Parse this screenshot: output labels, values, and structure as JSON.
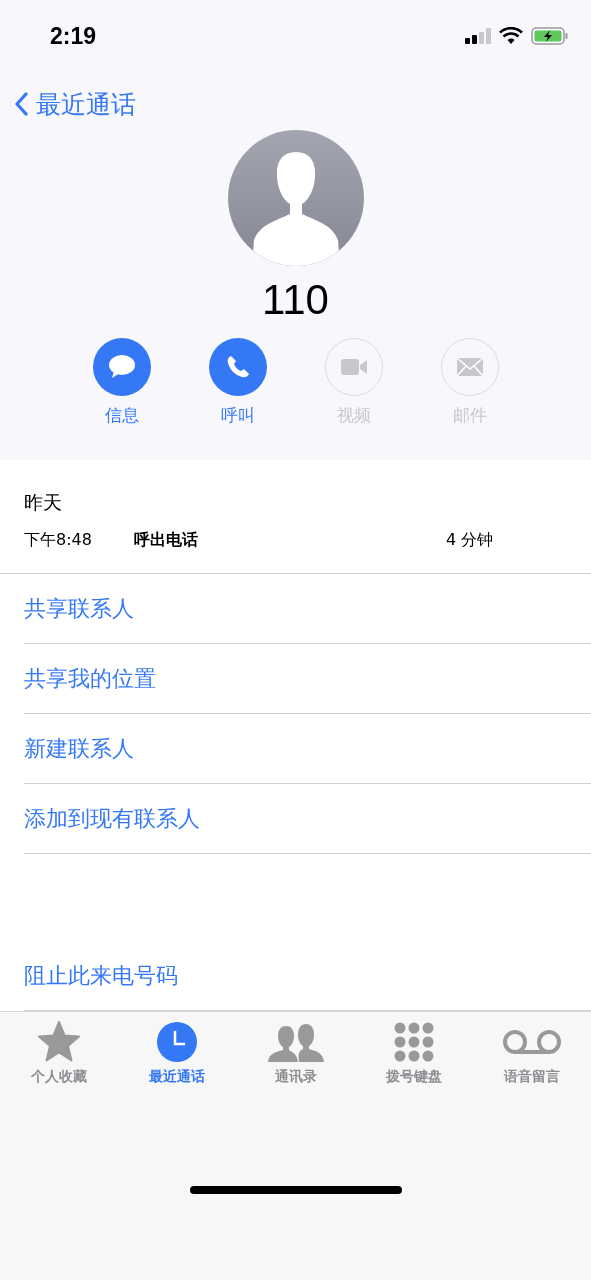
{
  "status_bar": {
    "time": "2:19"
  },
  "nav": {
    "back_label": "最近通话"
  },
  "contact": {
    "name": "110"
  },
  "actions": [
    {
      "kind": "message",
      "label": "信息",
      "disabled": false
    },
    {
      "kind": "call",
      "label": "呼叫",
      "disabled": false
    },
    {
      "kind": "video",
      "label": "视频",
      "disabled": true
    },
    {
      "kind": "mail",
      "label": "邮件",
      "disabled": true
    }
  ],
  "call_log": {
    "date": "昨天",
    "entries": [
      {
        "time": "下午8:48",
        "type": "呼出电话",
        "duration": "4 分钟"
      }
    ]
  },
  "options": [
    "共享联系人",
    "共享我的位置",
    "新建联系人",
    "添加到现有联系人"
  ],
  "block_option": "阻止此来电号码",
  "tab_bar": [
    {
      "kind": "favorites",
      "label": "个人收藏",
      "selected": false
    },
    {
      "kind": "recents",
      "label": "最近通话",
      "selected": true
    },
    {
      "kind": "contacts",
      "label": "通讯录",
      "selected": false
    },
    {
      "kind": "keypad",
      "label": "拨号键盘",
      "selected": false
    },
    {
      "kind": "voicemail",
      "label": "语音留言",
      "selected": false
    }
  ]
}
